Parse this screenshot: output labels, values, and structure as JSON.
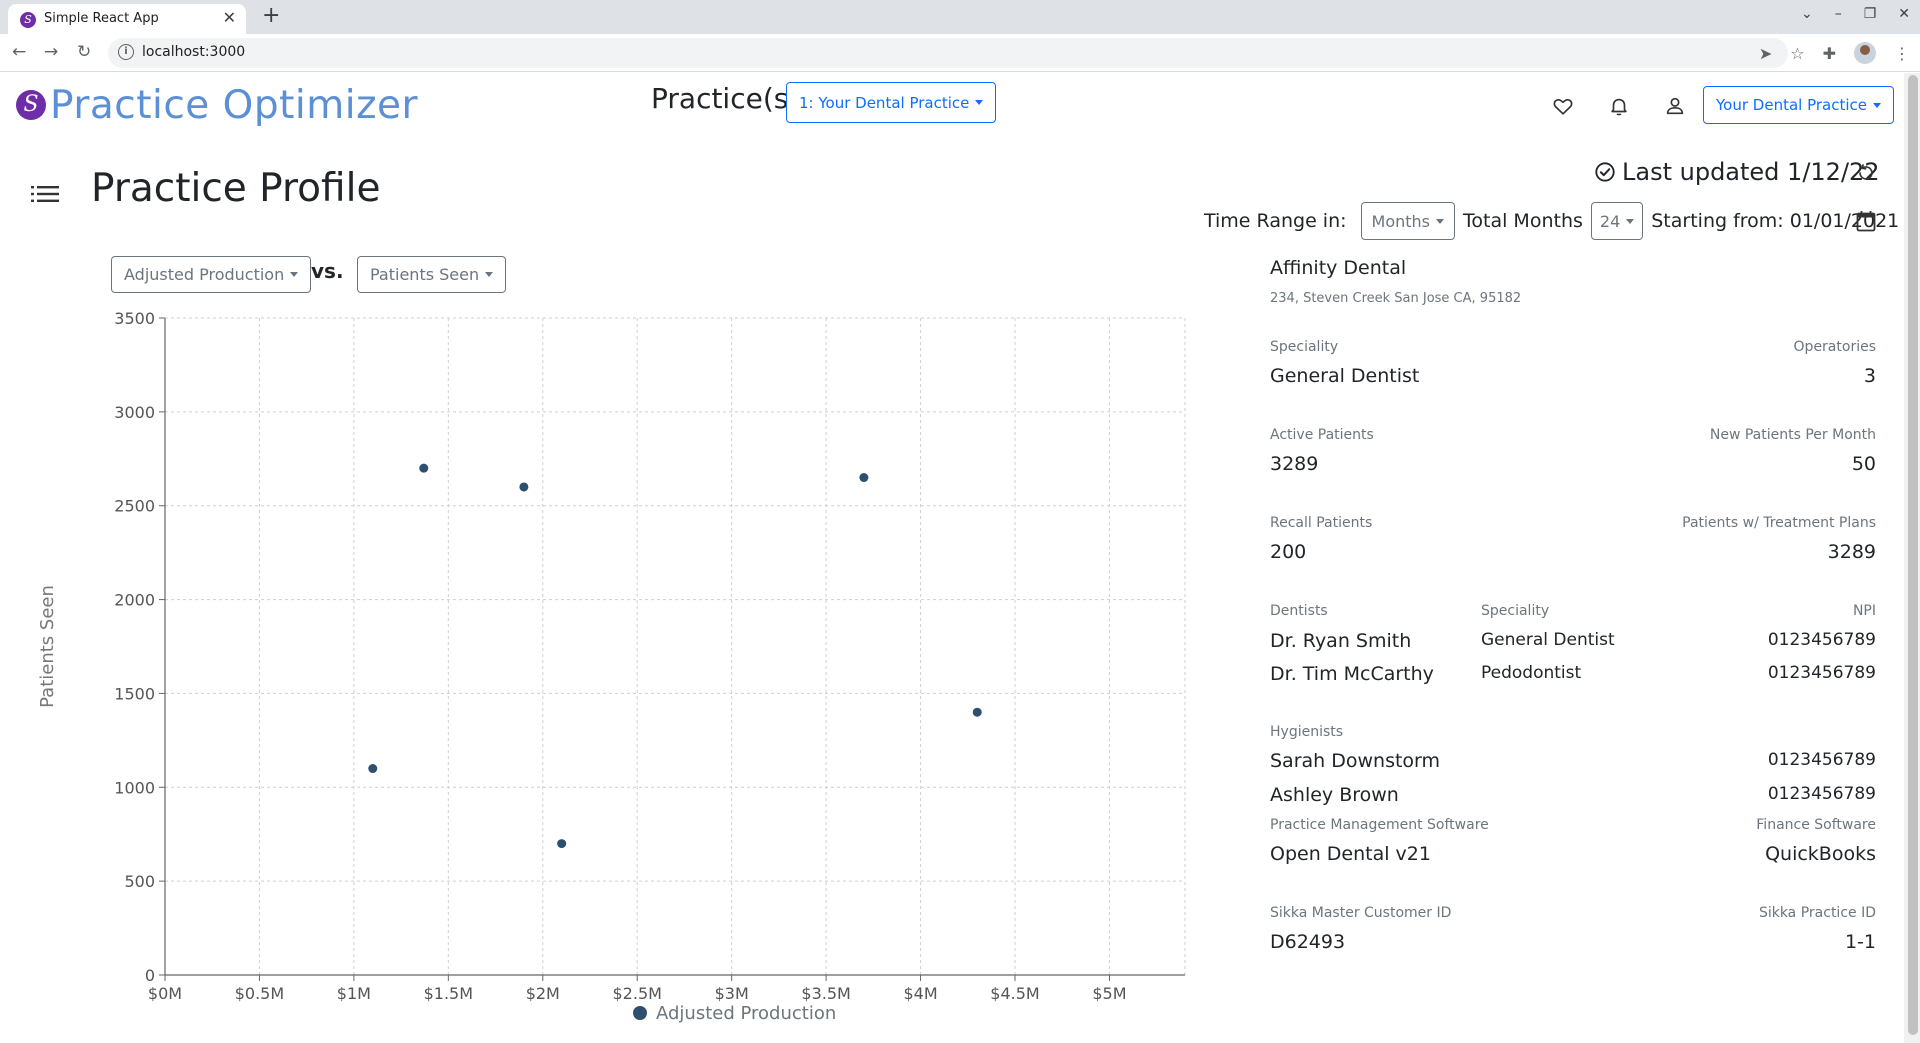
{
  "browser": {
    "tab_title": "Simple React App",
    "url": "localhost:3000"
  },
  "header": {
    "app_title": "Practice Optimizer",
    "practices_label": "Practice(s)",
    "practice_select": "1: Your Dental Practice",
    "account_select": "Your Dental Practice"
  },
  "page": {
    "title": "Practice Profile",
    "last_updated": "Last updated 1/12/22",
    "time_range_label": "Time Range in:",
    "time_unit": "Months",
    "total_months_label": "Total Months",
    "total_months": "24",
    "starting_from": "Starting from: 01/01/2021"
  },
  "chart_controls": {
    "x_metric": "Adjusted Production",
    "vs_label": "vs.",
    "y_metric": "Patients Seen"
  },
  "chart_data": {
    "type": "scatter",
    "xlabel": "Adjusted Production",
    "ylabel": "Patients Seen",
    "legend": "Adjusted Production",
    "xlim": [
      0,
      5400000
    ],
    "ylim": [
      0,
      3500
    ],
    "x_ticks": [
      "$0M",
      "$0.5M",
      "$1M",
      "$1.5M",
      "$2M",
      "$2.5M",
      "$3M",
      "$3.5M",
      "$4M",
      "$4.5M",
      "$5M"
    ],
    "x_tick_values": [
      0,
      500000,
      1000000,
      1500000,
      2000000,
      2500000,
      3000000,
      3500000,
      4000000,
      4500000,
      5000000
    ],
    "y_ticks": [
      "0",
      "500",
      "1000",
      "1500",
      "2000",
      "2500",
      "3000",
      "3500"
    ],
    "y_tick_values": [
      0,
      500,
      1000,
      1500,
      2000,
      2500,
      3000,
      3500
    ],
    "points": [
      {
        "x": 1100000,
        "y": 1100
      },
      {
        "x": 1370000,
        "y": 2700
      },
      {
        "x": 1900000,
        "y": 2600
      },
      {
        "x": 2100000,
        "y": 700
      },
      {
        "x": 3700000,
        "y": 2650
      },
      {
        "x": 4300000,
        "y": 1400
      }
    ],
    "grid": true,
    "point_color": "#2f4f6f",
    "legend_position": "bottom"
  },
  "profile": {
    "practice_name": "Affinity Dental",
    "address": "234, Steven Creek San Jose CA, 95182",
    "speciality_label": "Speciality",
    "speciality": "General Dentist",
    "operatories_label": "Operatories",
    "operatories": "3",
    "active_patients_label": "Active Patients",
    "active_patients": "3289",
    "new_patients_label": "New Patients Per Month",
    "new_patients": "50",
    "recall_patients_label": "Recall Patients",
    "recall_patients": "200",
    "treatment_plans_label": "Patients w/ Treatment Plans",
    "treatment_plans": "3289",
    "dentists_label": "Dentists",
    "dentist_speciality_label": "Speciality",
    "npi_label": "NPI",
    "dentists": [
      {
        "name": "Dr. Ryan Smith",
        "speciality": "General Dentist",
        "npi": "0123456789"
      },
      {
        "name": "Dr. Tim McCarthy",
        "speciality": "Pedodontist",
        "npi": "0123456789"
      }
    ],
    "hygienists_label": "Hygienists",
    "hygienists": [
      {
        "name": "Sarah Downstorm",
        "npi": "0123456789"
      },
      {
        "name": "Ashley Brown",
        "npi": "0123456789"
      }
    ],
    "pms_label": "Practice Management Software",
    "pms": "Open Dental v21",
    "finance_label": "Finance Software",
    "finance": "QuickBooks",
    "sikka_customer_label": "Sikka Master Customer ID",
    "sikka_customer": "D62493",
    "sikka_practice_label": "Sikka Practice ID",
    "sikka_practice": "1-1"
  },
  "colors": {
    "brand": "#6f2da8",
    "title_blue": "#5b8fd6",
    "primary": "#0d6efd",
    "secondary": "#6c757d"
  }
}
